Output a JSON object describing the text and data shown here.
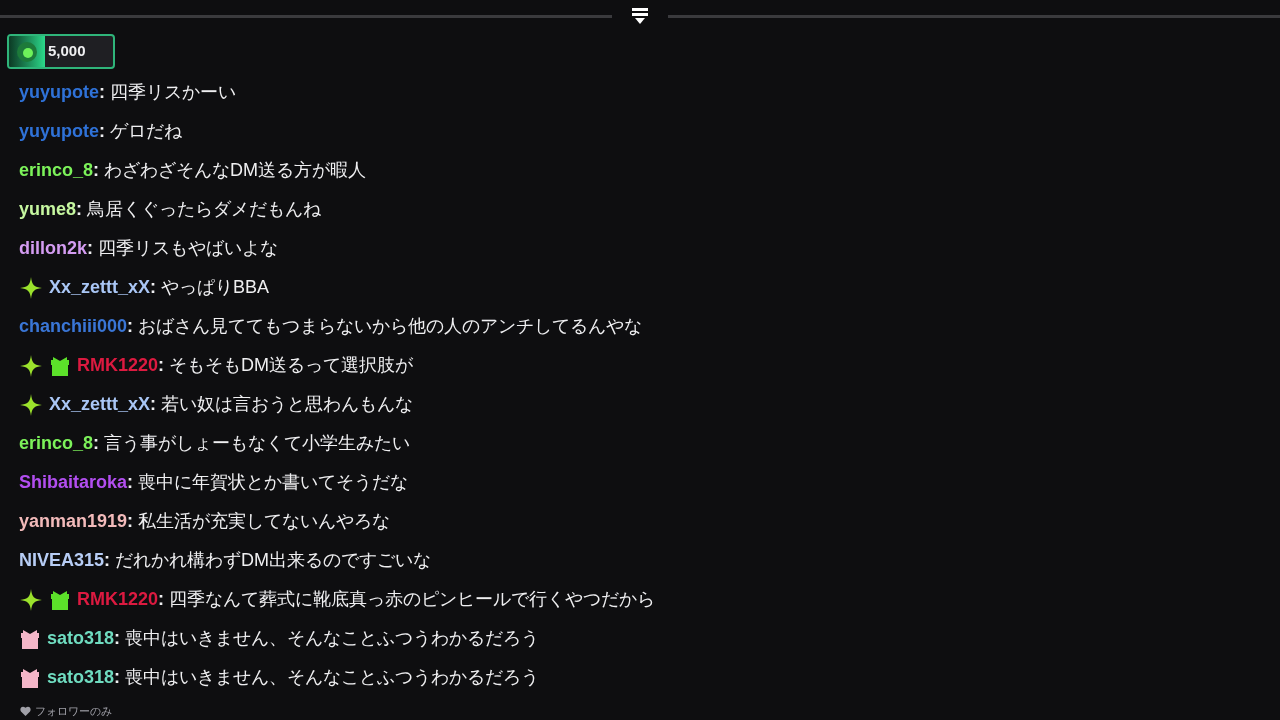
{
  "pinned": {
    "amount": "5,000"
  },
  "messages": [
    {
      "user": "yuyupote",
      "color": "#2f72d8",
      "text": "**:** 四季リスかーい"
    },
    {
      "user": "yuyupote",
      "color": "#2f72d8",
      "text": "**:** ゲロだね"
    },
    {
      "user": "erinco_8",
      "color": "#7cf25a",
      "text": "**:** わざわざそんなDM送る方が暇人"
    },
    {
      "user": "yume8",
      "color": "#c6f7a0",
      "text": "**:** 鳥居くぐったらダメだもんね"
    },
    {
      "user": "dillon2k",
      "color": "#d49cf2",
      "text": "**:** 四季リスもやばいよな"
    },
    {
      "user": "Xx_zettt_xX",
      "color": "#a9c6f5",
      "badges": [
        {
          "kind": "sparkle"
        }
      ],
      "text": "**:** やっぱりBBA"
    },
    {
      "user": "chanchiii000",
      "color": "#3a76d6",
      "text": "**:** おばさん見ててもつまらないから他の人のアンチしてるんやな"
    },
    {
      "user": "RMK1220",
      "color": "#dc1a40",
      "badges": [
        {
          "kind": "sparkle"
        },
        {
          "kind": "gift"
        }
      ],
      "text": "**:** そもそもDM送るって選択肢が"
    },
    {
      "user": "Xx_zettt_xX",
      "color": "#a9c6f5",
      "badges": [
        {
          "kind": "sparkle"
        }
      ],
      "text": "**:** 若い奴は言おうと思わんもんな"
    },
    {
      "user": "erinco_8",
      "color": "#7cf25a",
      "text": "**:** 言う事がしょーもなくて小学生みたい"
    },
    {
      "user": "Shibaitaroka",
      "color": "#b24ef0",
      "text": "**:** 喪中に年賀状とか書いてそうだな"
    },
    {
      "user": "yanman1919",
      "color": "#f2baba",
      "text": "**:** 私生活が充実してないんやろな"
    },
    {
      "user": "NIVEA315",
      "color": "#b7cdf5",
      "text": "**:** だれかれ構わずDM出来るのですごいな"
    },
    {
      "user": "RMK1220",
      "color": "#dc1a40",
      "badges": [
        {
          "kind": "sparkle"
        },
        {
          "kind": "gift"
        }
      ],
      "text": "**:** 四季なんて葬式に靴底真っ赤のピンヒールで行くやつだから"
    },
    {
      "user": "sato318",
      "color": "#6fdcc0",
      "badges": [
        {
          "kind": "gift_pink"
        }
      ],
      "text": "**:** 喪中はいきません、そんなことふつうわかるだろう"
    },
    {
      "user": "sato318",
      "color": "#6fdcc0",
      "badges": [
        {
          "kind": "gift_pink"
        }
      ],
      "text": "**:** 喪中はいきません、そんなことふつうわかるだろう"
    }
  ],
  "footer": {
    "label": "フォロワーのみ"
  }
}
